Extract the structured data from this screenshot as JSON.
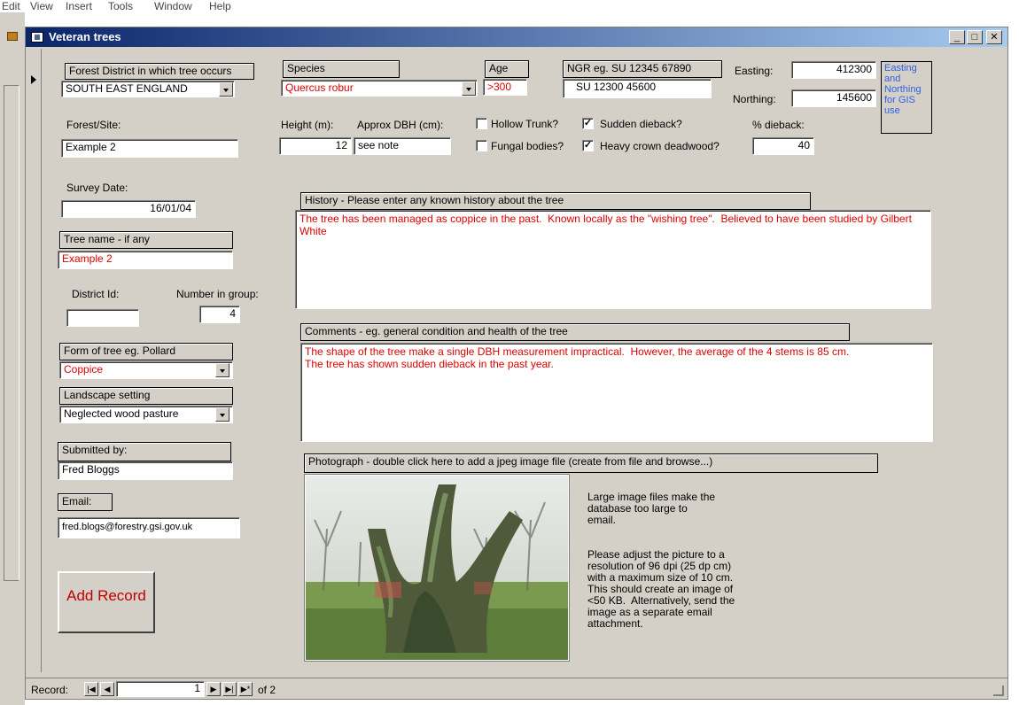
{
  "menu": [
    "Edit",
    "View",
    "Insert",
    "Tools",
    "Window",
    "Help"
  ],
  "window": {
    "title": "Veteran trees"
  },
  "fields": {
    "forest_district": {
      "label": "Forest District in which tree occurs",
      "value": "SOUTH EAST ENGLAND"
    },
    "species": {
      "label": "Species",
      "value": "Quercus robur"
    },
    "age": {
      "label": "Age",
      "value": ">300"
    },
    "ngr": {
      "label": "NGR  eg.  SU 12345 67890",
      "value": "SU  12300  45600"
    },
    "easting": {
      "label": "Easting:",
      "value": "412300"
    },
    "northing": {
      "label": "Northing:",
      "value": "145600"
    },
    "gis_note": "Easting and Northing for GIS use",
    "forest_site": {
      "label": "Forest/Site:",
      "value": "Example 2"
    },
    "height": {
      "label": "Height (m):",
      "value": "12"
    },
    "dbh": {
      "label": "Approx DBH (cm):",
      "value": "see note"
    },
    "hollow_trunk": {
      "label": "Hollow Trunk?",
      "checked": false
    },
    "fungal_bodies": {
      "label": "Fungal bodies?",
      "checked": false
    },
    "sudden_dieback": {
      "label": "Sudden dieback?",
      "checked": true
    },
    "heavy_crown": {
      "label": "Heavy crown deadwood?",
      "checked": true
    },
    "dieback_pct": {
      "label": "% dieback:",
      "value": "40"
    },
    "survey_date": {
      "label": "Survey Date:",
      "value": "16/01/04"
    },
    "tree_name": {
      "label": "Tree name - if any",
      "value": "Example 2"
    },
    "district_id": {
      "label": "District Id:",
      "value": ""
    },
    "number_in_group": {
      "label": "Number in group:",
      "value": "4"
    },
    "form": {
      "label": "Form of tree  eg. Pollard",
      "value": "Coppice"
    },
    "landscape": {
      "label": "Landscape setting",
      "value": "Neglected wood pasture"
    },
    "submitted_by": {
      "label": "Submitted by:",
      "value": "Fred Bloggs"
    },
    "email": {
      "label": "Email:",
      "value": "fred.blogs@forestry.gsi.gov.uk"
    },
    "history": {
      "label": "History - Please enter any known history about the tree",
      "value": "The tree has been managed as coppice in the past.  Known locally as the \"wishing tree\".  Believed to have been studied by Gilbert White"
    },
    "comments": {
      "label": "Comments -  eg. general condition and health of the tree",
      "value": "The shape of the tree make a single DBH measurement impractical.  However, the average of the 4 stems is 85 cm.\nThe tree has shown sudden dieback in the past year."
    },
    "photo": {
      "label": "Photograph - double click here to add a jpeg image file (create from file and browse...)"
    }
  },
  "photo_note_1": "Large image files make the\ndatabase too large to\nemail.",
  "photo_note_2": "Please adjust the picture to a\nresolution of 96 dpi (25 dp cm)\nwith a maximum size of 10 cm.\nThis should create an image of\n<50 KB.  Alternatively, send the\nimage as a separate email\nattachment.",
  "add_record_label": "Add Record",
  "statusbar": {
    "record_label": "Record:",
    "current": "1",
    "total_text": "of  2"
  }
}
